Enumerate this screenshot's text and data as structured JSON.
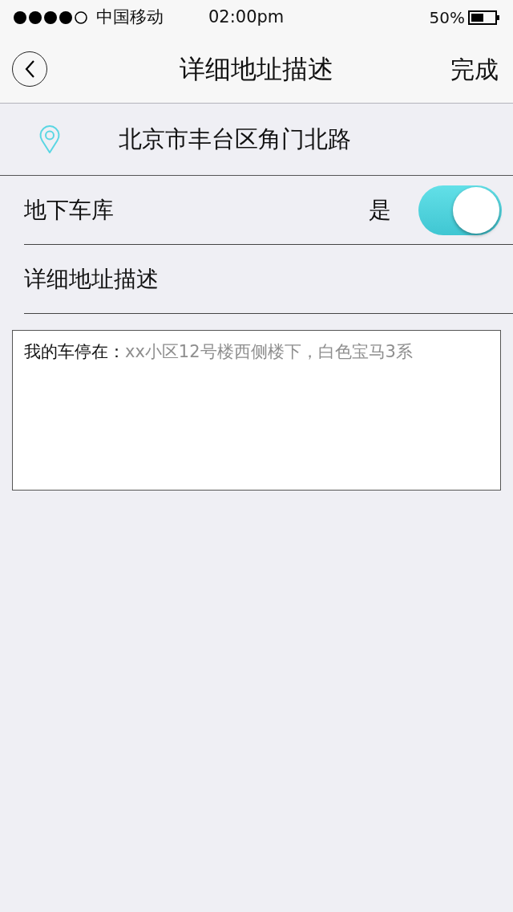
{
  "status_bar": {
    "carrier": "中国移动",
    "time": "02:00pm",
    "battery": "50%"
  },
  "nav": {
    "title": "详细地址描述",
    "action": "完成"
  },
  "location": {
    "address": "北京市丰台区角门北路"
  },
  "rows": [
    {
      "kind": "toggle",
      "label": "地下车库",
      "value": "是",
      "on": true
    },
    {
      "kind": "heading",
      "label": "详细地址描述"
    }
  ],
  "description": {
    "prefix": "我的车停在：",
    "placeholder": "xx小区12号楼西侧楼下，白色宝马3系"
  }
}
